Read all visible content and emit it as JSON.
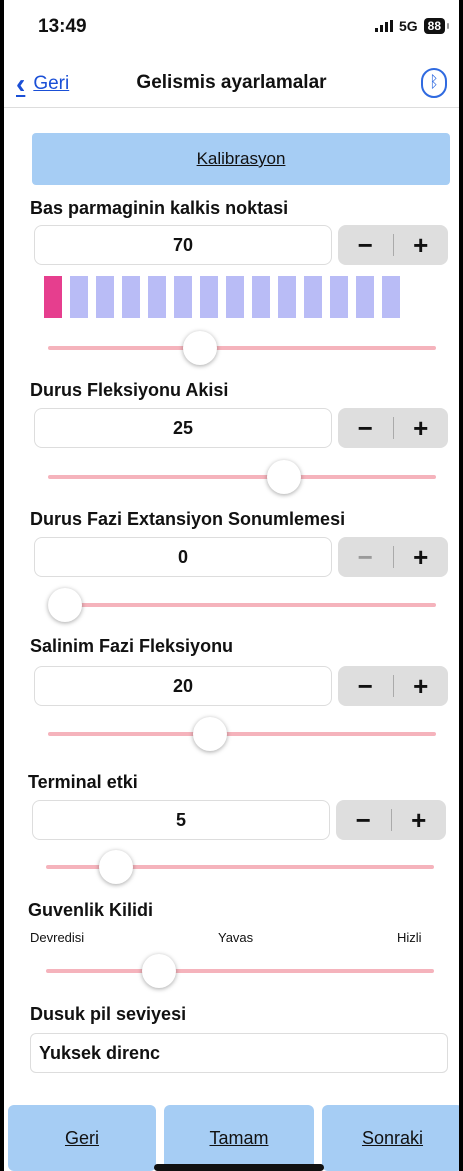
{
  "status": {
    "time": "13:49",
    "network": "5G",
    "battery": "88"
  },
  "nav": {
    "back_label": "Geri",
    "title": "Gelismis ayarlamalar"
  },
  "calibration_label": "Kalibrasyon",
  "settings": [
    {
      "label": "Bas parmaginin kalkis noktasi",
      "value": "70",
      "slider_fraction": 0.38,
      "minus_enabled": true
    },
    {
      "label": "Durus Fleksiyonu Akisi",
      "value": "25",
      "slider_fraction": 0.62,
      "minus_enabled": true
    },
    {
      "label": "Durus Fazi Extansiyon Sonumlemesi",
      "value": "0",
      "slider_fraction": 0.0,
      "minus_enabled": false
    },
    {
      "label": "Salinim Fazi Fleksiyonu",
      "value": "20",
      "slider_fraction": 0.41,
      "minus_enabled": true
    },
    {
      "label": "Terminal etki",
      "value": "5",
      "slider_fraction": 0.15,
      "minus_enabled": true
    }
  ],
  "bars": {
    "total": 14,
    "active": 1
  },
  "stepper": {
    "minus": "−",
    "plus": "+"
  },
  "safety": {
    "label": "Guvenlik Kilidi",
    "options": [
      "Devredisi",
      "Yavas",
      "Hizli"
    ],
    "slider_fraction": 0.27
  },
  "battery_level": {
    "label": "Dusuk pil seviyesi",
    "value": "Yuksek direnc"
  },
  "bottom": {
    "back": "Geri",
    "ok": "Tamam",
    "next": "Sonraki"
  },
  "colors": {
    "accent": "#a6cdf4",
    "link": "#1a4fd6",
    "bar_inactive": "#b9bcf6",
    "bar_active": "#e63e8e",
    "track": "#f5b3bc"
  }
}
